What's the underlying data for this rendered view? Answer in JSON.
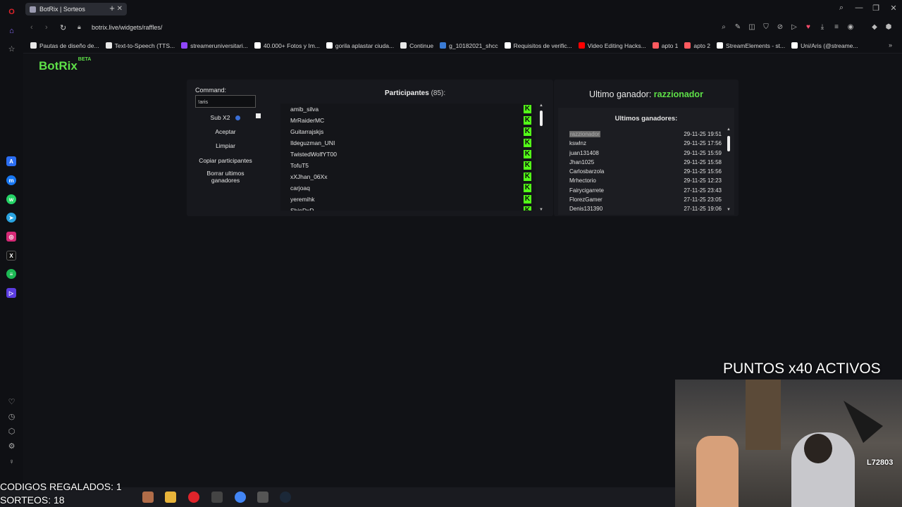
{
  "browser": {
    "tab_title": "BotRix | Sorteos",
    "url": "botrix.live/widgets/raffles/",
    "bookmarks": [
      {
        "label": "Pautas de diseño de...",
        "color": "#e8e8e8"
      },
      {
        "label": "Text-to-Speech (TTS...",
        "color": "#e8e8e8"
      },
      {
        "label": "streameruniversitari...",
        "color": "#9146ff"
      },
      {
        "label": "40.000+ Fotos y Im...",
        "color": "#ffffff"
      },
      {
        "label": "gorila aplastar ciuda...",
        "color": "#ffffff"
      },
      {
        "label": "Continue",
        "color": "#e8e8e8"
      },
      {
        "label": "g_10182021_shcc",
        "color": "#3a7bd5"
      },
      {
        "label": "Requisitos de verific...",
        "color": "#ffffff"
      },
      {
        "label": "Video Editing Hacks...",
        "color": "#ff0000"
      },
      {
        "label": "apto 1",
        "color": "#ff5a5f"
      },
      {
        "label": "apto 2",
        "color": "#ff5a5f"
      },
      {
        "label": "StreamElements - st...",
        "color": "#ffffff"
      },
      {
        "label": "Uni/Aris (@streame...",
        "color": "#ffffff"
      }
    ]
  },
  "app": {
    "brand": "BotRix",
    "brand_tag": "BETA",
    "command_label": "Command:",
    "command_value": "!aris",
    "sub_label": "Sub X2",
    "accept": "Aceptar",
    "clear": "Limpiar",
    "copy": "Copiar participantes",
    "delete_winners": "Borrar ultimos ganadores",
    "participants_title": "Participantes",
    "participants_count": "(85):",
    "participants": [
      "amib_silva",
      "MrRaiderMC",
      "Guitarrajskjs",
      "Ildeguzman_UNI",
      "TwistedWolfYT00",
      "TofuT5",
      "xXJhan_06Xx",
      "carjoaq",
      "yeremihk",
      "ShinDxD"
    ],
    "last_winner_label": "Ultimo ganador:",
    "last_winner": "razzionador",
    "winners_title": "Ultimos ganadores:",
    "winners": [
      {
        "name": "razzionador",
        "date": "29-11-25 19:51"
      },
      {
        "name": "kswlnz",
        "date": "29-11-25 17:56"
      },
      {
        "name": "juan131408",
        "date": "29-11-25 15:59"
      },
      {
        "name": "Jhan1025",
        "date": "29-11-25 15:58"
      },
      {
        "name": "Carlosbarzola",
        "date": "29-11-25 15:56"
      },
      {
        "name": "Mrhectorio",
        "date": "29-11-25 12:23"
      },
      {
        "name": "Fairycigarrete",
        "date": "27-11-25 23:43"
      },
      {
        "name": "FlorezGamer",
        "date": "27-11-25 23:05"
      },
      {
        "name": "Denis131390",
        "date": "27-11-25 19:06"
      }
    ]
  },
  "overlay": {
    "codes": "CODIGOS REGALADOS: 1",
    "raffles": "SORTEOS: 18",
    "points": "PUNTOS x40 ACTIVOS",
    "cam_badge": "L72803"
  },
  "colors": {
    "accent_green": "#5ee048",
    "kick_green": "#53fc18"
  }
}
